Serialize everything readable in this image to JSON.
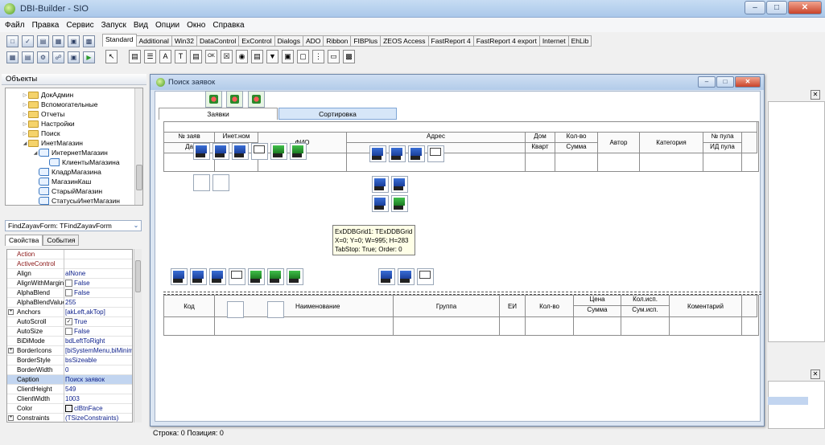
{
  "window": {
    "title": "DBI-Builder - SIO"
  },
  "menu": [
    "Файл",
    "Правка",
    "Сервис",
    "Запуск",
    "Вид",
    "Опции",
    "Окно",
    "Справка"
  ],
  "palette_tabs": [
    "Standard",
    "Additional",
    "Win32",
    "DataControl",
    "ExControl",
    "Dialogs",
    "ADO",
    "Ribbon",
    "FIBPlus",
    "ZEOS Access",
    "FastReport 4",
    "FastReport 4 export",
    "Internet",
    "EhLib"
  ],
  "objects_panel": {
    "title": "Объекты",
    "tree": [
      "ДокАдмин",
      "Вспомогательные",
      "Отчеты",
      "Настройки",
      "Поиск",
      "ИнетМагазин",
      "ИнтернетМагазин",
      "КлиентыМагазина",
      "КладрМагазина",
      "МагазинКаш",
      "СтарыйМагазин",
      "СтатусыИнетМагазин"
    ]
  },
  "inspector": {
    "component": "FindZayavForm: TFindZayavForm",
    "tabs": [
      "Свойства",
      "События"
    ],
    "props": [
      {
        "name": "Action",
        "value": ""
      },
      {
        "name": "ActiveControl",
        "value": ""
      },
      {
        "name": "Align",
        "value": "alNone"
      },
      {
        "name": "AlignWithMargins",
        "value": "False"
      },
      {
        "name": "AlphaBlend",
        "value": "False"
      },
      {
        "name": "AlphaBlendValue",
        "value": "255"
      },
      {
        "name": "Anchors",
        "value": "[akLeft,akTop]"
      },
      {
        "name": "AutoScroll",
        "value": "True"
      },
      {
        "name": "AutoSize",
        "value": "False"
      },
      {
        "name": "BiDiMode",
        "value": "bdLeftToRight"
      },
      {
        "name": "BorderIcons",
        "value": "[biSystemMenu,biMinimize]"
      },
      {
        "name": "BorderStyle",
        "value": "bsSizeable"
      },
      {
        "name": "BorderWidth",
        "value": "0"
      },
      {
        "name": "Caption",
        "value": "Поиск заявок"
      },
      {
        "name": "ClientHeight",
        "value": "549"
      },
      {
        "name": "ClientWidth",
        "value": "1003"
      },
      {
        "name": "Color",
        "value": "clBtnFace"
      },
      {
        "name": "Constraints",
        "value": "(TSizeConstraints)"
      }
    ]
  },
  "status_bar": "Строка: 0 Позиция: 0",
  "form": {
    "title": "Поиск заявок",
    "tabs": [
      "Заявки",
      "Сортировка"
    ],
    "grid1": {
      "h_nzayav": "№ заяв",
      "h_date": "Да",
      "h_inetnom": "Инет.ном",
      "h_fio": "ФИО",
      "h_addr": "Адрес",
      "h_dom": "Дом",
      "h_kvart": "Кварт",
      "h_kolvo": "Кол-во",
      "h_summa": "Сумма",
      "h_avtor": "Автор",
      "h_kateg": "Категория",
      "h_npula": "№ пула",
      "h_idpula": "ИД пула"
    },
    "grid2": {
      "h_kod": "Код",
      "h_naim": "Наименование",
      "h_gruppa": "Группа",
      "h_ei": "ЕИ",
      "h_kolvo": "Кол-во",
      "h_cena": "Цена",
      "h_summa": "Сумма",
      "h_kolisp": "Кол.исп.",
      "h_sumisp": "Сум.исп.",
      "h_koment": "Коментарий"
    },
    "tooltip": {
      "line1": "ExDDBGrid1: TExDDBGrid",
      "line2": "X=0; Y=0; W=995; H=283",
      "line3": "TabStop: True; Order: 0"
    }
  }
}
